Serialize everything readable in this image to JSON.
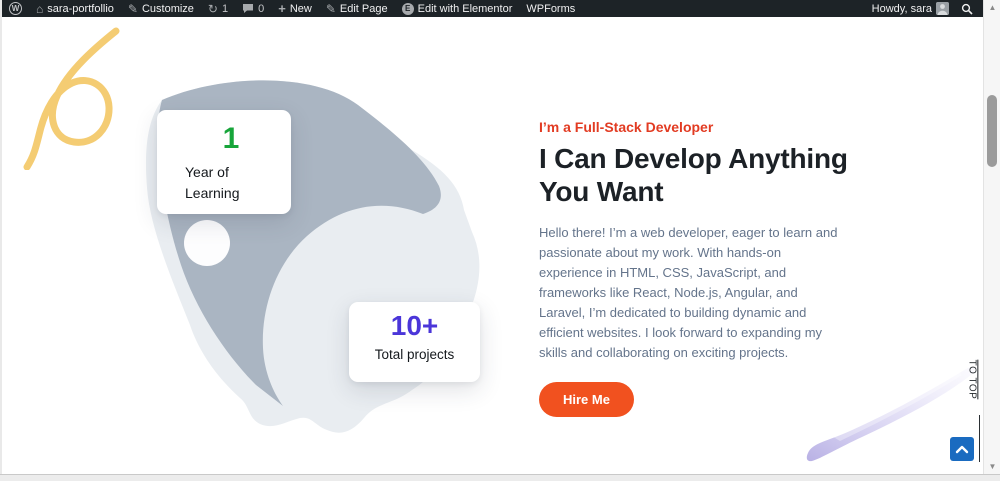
{
  "admin_bar": {
    "site_name": "sara-portfollio",
    "customize_label": "Customize",
    "updates_count": "1",
    "comments_count": "0",
    "new_label": "New",
    "edit_page_label": "Edit Page",
    "elementor_label": "Edit with Elementor",
    "wpforms_label": "WPForms",
    "howdy": "Howdy, sara"
  },
  "hero": {
    "subtitle": "I’m a Full-Stack Developer",
    "title": "I Can Develop Anything You Want",
    "description": "Hello there! I’m a web developer, eager to learn and passionate about my work. With hands-on experience in HTML, CSS, JavaScript, and frameworks like React, Node.js, Angular, and Laravel, I’m dedicated to building dynamic and efficient websites. I look forward to expanding my skills and collaborating on exciting projects.",
    "cta_label": "Hire Me",
    "stats": [
      {
        "value": "1",
        "label": "Year of Learning",
        "value_color": "#17a53a"
      },
      {
        "value": "10+",
        "label": "Total projects",
        "value_color": "#4b36d9"
      }
    ]
  },
  "to_top": {
    "label": "TO TOP"
  },
  "colors": {
    "adminbar_bg": "#1d2327",
    "subtitle_red": "#e23b22",
    "cta_orange": "#f1511f",
    "stat_green": "#17a53a",
    "stat_purple": "#4b36d9",
    "totop_blue": "#1a6bc0",
    "map_dark": "#aab5c2",
    "map_light": "#e9edf1",
    "squiggle_yellow": "#f3c96b",
    "brush_lavender": "#b4abe4"
  }
}
